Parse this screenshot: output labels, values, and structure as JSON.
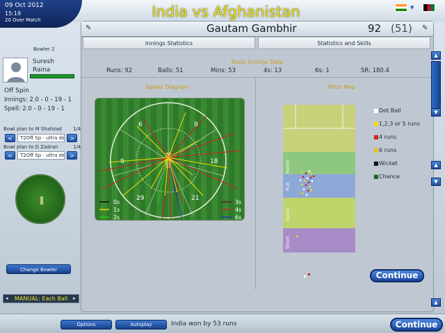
{
  "header": {
    "date": "09 Oct 2012",
    "time": "15:19",
    "match_type": "20 Over Match",
    "match_title": "India vs Afghanistan"
  },
  "bowler": {
    "slot_label": "Bowler 2",
    "first_name": "Suresh",
    "last_name": "Raina",
    "energy_pct": 100,
    "style": "Off Spin",
    "innings": "Innings: 2.0 - 0 - 19 - 1",
    "spell": "Spell: 2.0 - 0 - 19 - 1"
  },
  "bowl_plans": [
    {
      "label": "Bowl plan to M Shahzad",
      "count": "1/4",
      "tactic": "T2Off Sp - ultra def"
    },
    {
      "label": "Bowl plan to D Zadran",
      "count": "1/4",
      "tactic": "T2Off Sp - ultra def"
    }
  ],
  "buttons": {
    "change_bowler": "Change Bowler",
    "manual": "MANUAL: Each Ball",
    "continue_inner": "Continue",
    "continue_main": "Continue",
    "options": "Options",
    "autoplay": "Autoplay"
  },
  "panel": {
    "player_name": "Gautam Gambhir",
    "runs": "92",
    "balls": "(51)",
    "tabs": [
      "Innings Statistics",
      "Statistics and Skills"
    ],
    "basic_title": "Basic Innings Data",
    "stats": {
      "runs": "Runs: 92",
      "balls": "Balls: 51",
      "mins": "Mins: 53",
      "fours": "4s: 13",
      "sixes": "6s: 1",
      "sr": "SR: 180.4"
    },
    "spider_title": "Spider Diagram",
    "pitch_title": "Pitch Map"
  },
  "spider": {
    "zone_labels": [
      "6",
      "9",
      "9",
      "18",
      "29",
      "21"
    ],
    "legend_left": [
      "0s",
      "1s",
      "2s"
    ],
    "legend_right": [
      "3s",
      "4s",
      "6s"
    ],
    "colors": {
      "0s": "#111111",
      "1s": "#f0e000",
      "2s": "#20d020",
      "3s": "#6a1a1a",
      "4s": "#d02020",
      "6s": "#2030d0"
    }
  },
  "pitch_map": {
    "zone_labels": [
      "Yorker",
      "Full",
      "Good",
      "Short"
    ],
    "legend": [
      "Dot Ball",
      "1,2,3 or 5 runs",
      "4 runs",
      "6 runs",
      "Wicket",
      "Chance"
    ],
    "legend_colors": [
      "#ffffff",
      "#f0e000",
      "#d02020",
      "#e0c020",
      "#111111",
      "#1a6a1a"
    ]
  },
  "footer": {
    "result": "India won by 53 runs"
  }
}
